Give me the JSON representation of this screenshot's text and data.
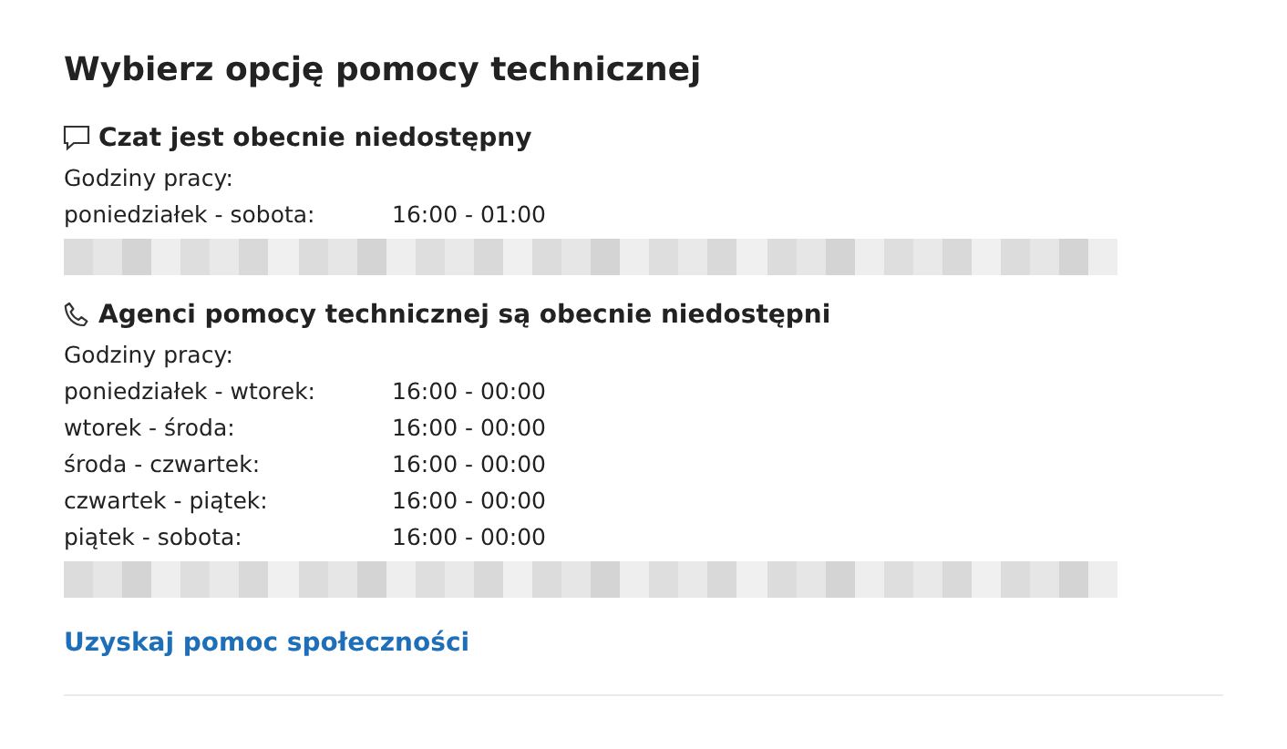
{
  "title": "Wybierz opcję pomocy technicznej",
  "sections": [
    {
      "kind": "chat",
      "heading": "Czat jest obecnie niedostępny",
      "hours_label": "Godziny pracy:",
      "hours": [
        {
          "days": "poniedziałek - sobota:",
          "time": "16:00 - 01:00"
        }
      ]
    },
    {
      "kind": "phone",
      "heading": "Agenci pomocy technicznej są obecnie niedostępni",
      "hours_label": "Godziny pracy:",
      "hours": [
        {
          "days": "poniedziałek - wtorek:",
          "time": "16:00 - 00:00"
        },
        {
          "days": "wtorek - środa:",
          "time": "16:00 - 00:00"
        },
        {
          "days": "środa - czwartek:",
          "time": "16:00 - 00:00"
        },
        {
          "days": "czwartek - piątek:",
          "time": "16:00 - 00:00"
        },
        {
          "days": "piątek - sobota:",
          "time": "16:00 - 00:00"
        }
      ]
    }
  ],
  "community_link": "Uzyskaj pomoc społeczności"
}
